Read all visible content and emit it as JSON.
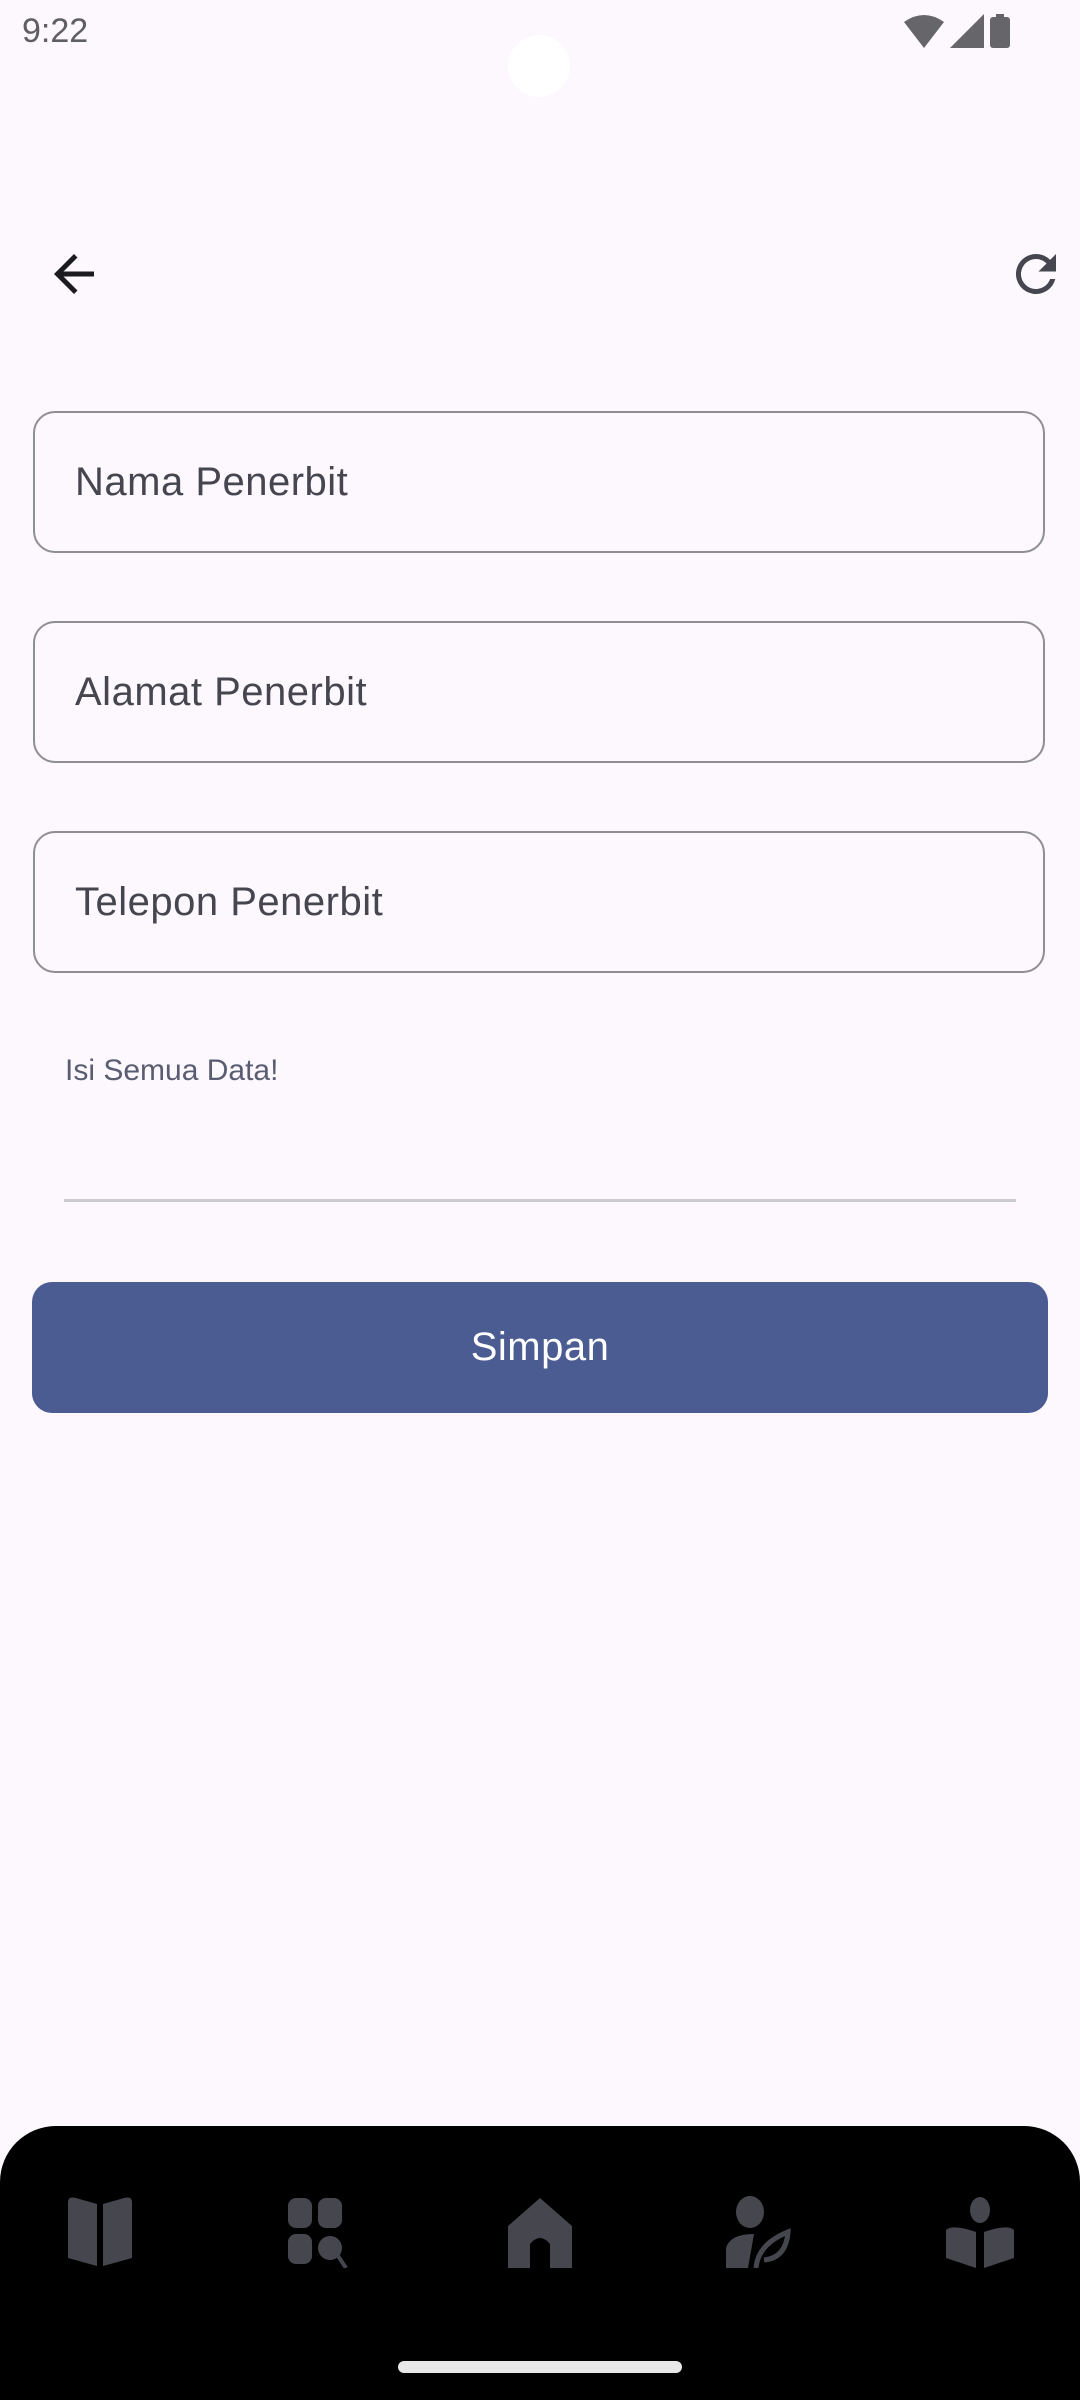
{
  "status_bar": {
    "time": "9:22",
    "icons": [
      "wifi-icon",
      "signal-icon",
      "battery-icon"
    ]
  },
  "toolbar": {
    "back_icon": "arrow-back-icon",
    "refresh_icon": "refresh-icon"
  },
  "form": {
    "fields": [
      {
        "placeholder": "Nama Penerbit",
        "value": ""
      },
      {
        "placeholder": "Alamat Penerbit",
        "value": ""
      },
      {
        "placeholder": "Telepon Penerbit",
        "value": ""
      }
    ],
    "helper_text": "Isi Semua Data!",
    "submit_label": "Simpan"
  },
  "bottom_nav": {
    "items": [
      {
        "icon": "book-icon"
      },
      {
        "icon": "category-search-icon"
      },
      {
        "icon": "home-icon"
      },
      {
        "icon": "author-icon"
      },
      {
        "icon": "reader-icon"
      }
    ]
  },
  "colors": {
    "primary": "#4a5c92",
    "background": "#fcf8fd",
    "nav_icon": "#46464f"
  }
}
